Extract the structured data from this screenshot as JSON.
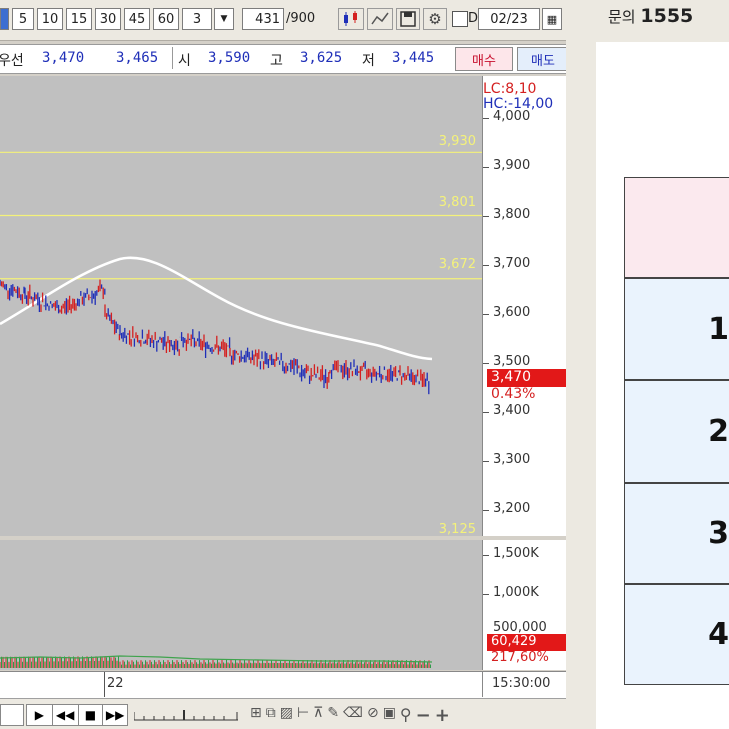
{
  "toolbar": {
    "period_buttons": [
      "5",
      "10",
      "15",
      "30",
      "45",
      "60"
    ],
    "interval_value": "3",
    "count_value": "431",
    "count_total": "/900",
    "date_checkbox_label": "D",
    "date_value": "02/23"
  },
  "quote": {
    "name_fragment": "우선",
    "current": "3,470",
    "prev": "3,465",
    "open_label": "시",
    "open": "3,590",
    "high_label": "고",
    "high": "3,625",
    "low_label": "저",
    "low": "3,445",
    "buy_label": "매수",
    "sell_label": "매도"
  },
  "price_axis": {
    "lc": "LC:8,10",
    "hc": "HC:-14,00",
    "ticks": [
      "4,000",
      "3,900",
      "3,800",
      "3,700",
      "3,600",
      "3,500",
      "3,400",
      "3,300",
      "3,200"
    ],
    "current_price": "3,470",
    "current_change": "0.43%"
  },
  "levels": [
    "3,930",
    "3,801",
    "3,672",
    "3,125"
  ],
  "volume_axis": {
    "ticks": [
      "1,500K",
      "1,000K",
      "500,000"
    ],
    "current_volume": "60,429",
    "volume_ratio": "217,60%"
  },
  "timebar": {
    "day_label": "22",
    "time_label": "15:30:00"
  },
  "nav": {
    "zoom_minus": "−",
    "zoom_plus": "+"
  },
  "right_panel": {
    "header_prefix": "문의",
    "header_number": "1555",
    "rows": [
      "1",
      "2",
      "3",
      "4"
    ]
  },
  "colors": {
    "up": "#d42020",
    "down": "#1f2fb8",
    "level_line": "#f4f27a",
    "moving_average": "#ffffff",
    "plot_bg": "#c0c0c0",
    "price_tag_bg": "#e21818",
    "table_header_bg": "#fbe9ee",
    "table_cell_bg": "#eaf3fd"
  }
}
